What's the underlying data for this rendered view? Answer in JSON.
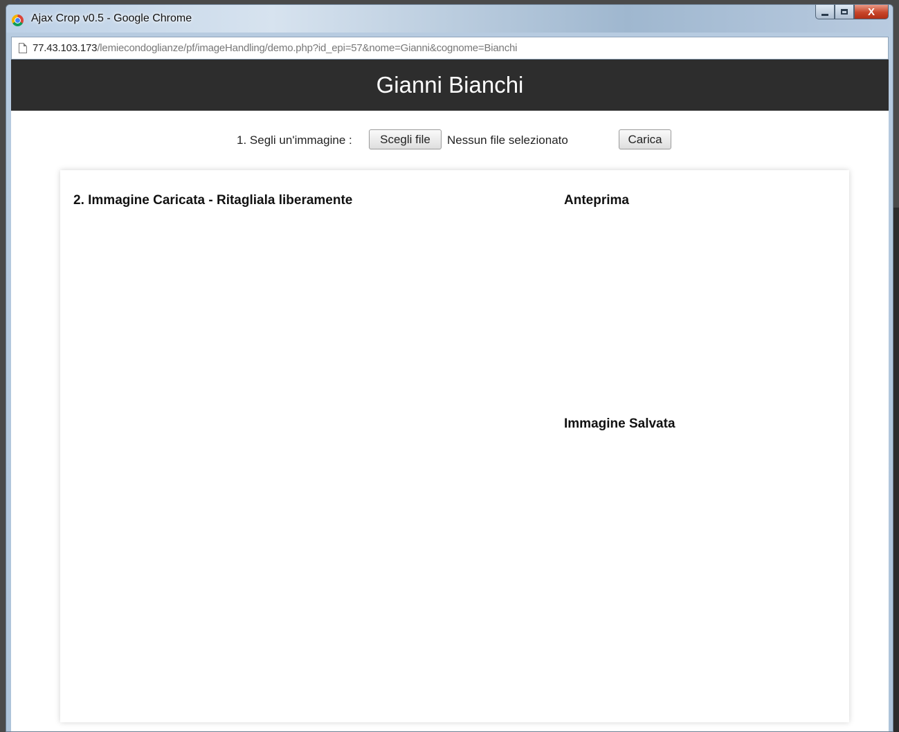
{
  "window": {
    "title": "Ajax Crop v0.5 - Google Chrome",
    "controls": {
      "minimize": "minimize-icon",
      "maximize": "maximize-icon",
      "close": "X"
    }
  },
  "address_bar": {
    "host": "77.43.103.173",
    "path": "/lemiecondoglianze/pf/imageHandling/demo.php?id_epi=57&nome=Gianni&cognome=Bianchi",
    "icon": "page-icon"
  },
  "page": {
    "header_title": "Gianni Bianchi",
    "upload": {
      "label": "1. Segli un'immagine :",
      "choose_button": "Scegli file",
      "no_file_text": "Nessun file selezionato",
      "upload_button": "Carica"
    },
    "panel": {
      "crop_heading": "2. Immagine Caricata - Ritagliala liberamente",
      "preview_heading": "Anteprima",
      "saved_heading": "Immagine Salvata"
    }
  },
  "colors": {
    "header_bg": "#2d2d2d",
    "header_text": "#ffffff",
    "page_bg": "#ffffff"
  }
}
